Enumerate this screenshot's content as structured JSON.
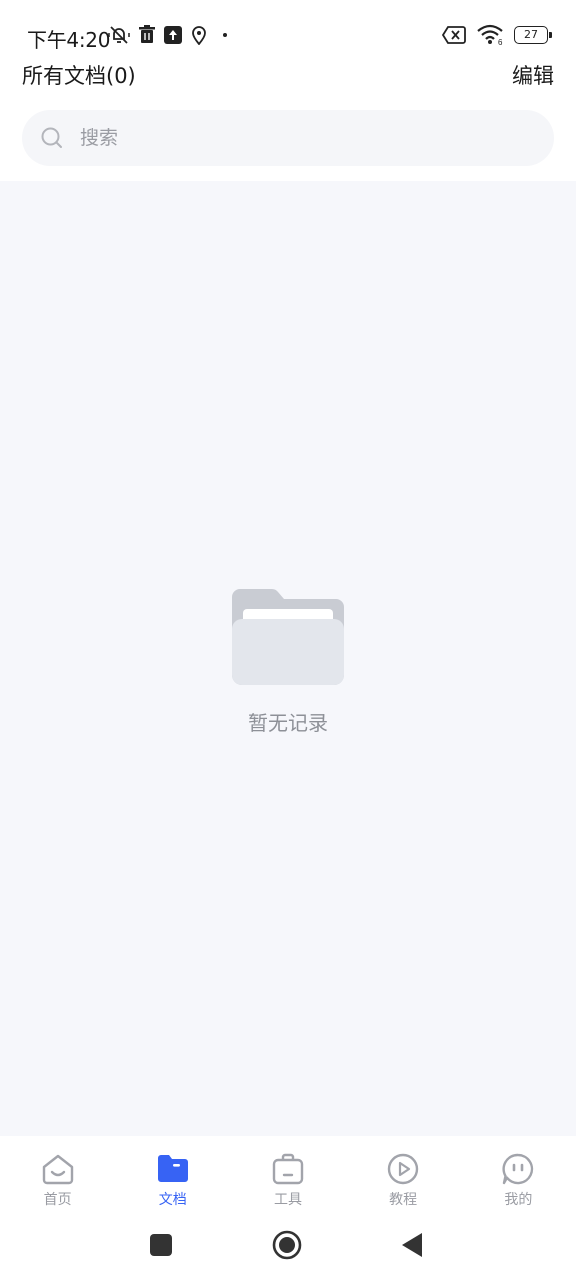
{
  "status_bar": {
    "time": "下午4:20",
    "battery_level": "27",
    "wifi_label": "6"
  },
  "header": {
    "title": "所有文档(0)",
    "edit_label": "编辑"
  },
  "search": {
    "placeholder": "搜索"
  },
  "empty_state": {
    "text": "暂无记录"
  },
  "bottom_nav": {
    "items": [
      {
        "label": "首页",
        "icon": "home-icon",
        "active": false
      },
      {
        "label": "文档",
        "icon": "document-folder-icon",
        "active": true
      },
      {
        "label": "工具",
        "icon": "toolbox-icon",
        "active": false
      },
      {
        "label": "教程",
        "icon": "play-circle-icon",
        "active": false
      },
      {
        "label": "我的",
        "icon": "profile-face-icon",
        "active": false
      }
    ]
  },
  "colors": {
    "accent": "#3763f4",
    "inactive": "#9a9ca3",
    "content_bg": "#f6f7fb"
  }
}
